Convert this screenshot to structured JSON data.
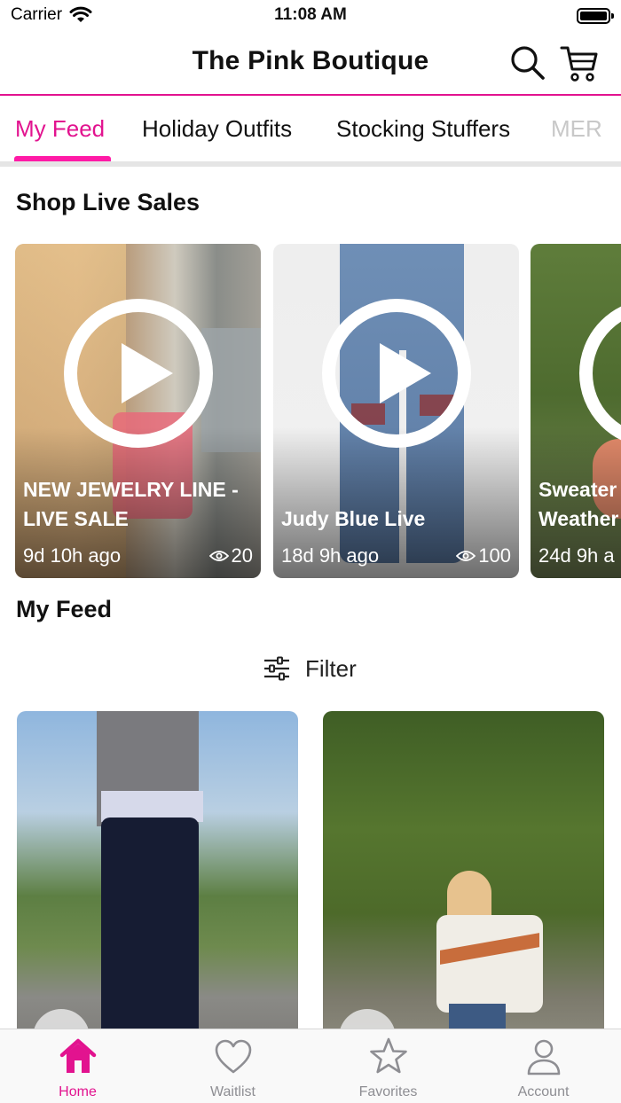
{
  "status_bar": {
    "carrier": "Carrier",
    "time": "11:08 AM"
  },
  "header": {
    "title": "The Pink Boutique",
    "search_icon": "search-icon",
    "cart_icon": "cart-icon"
  },
  "tabs": [
    {
      "label": "My Feed",
      "active": true
    },
    {
      "label": "Holiday Outfits"
    },
    {
      "label": "Stocking Stuffers"
    },
    {
      "label": "MER"
    }
  ],
  "live_section": {
    "title": "Shop Live Sales",
    "cards": [
      {
        "title": "NEW JEWELRY LINE -\nLIVE SALE",
        "ago": "9d 10h ago",
        "views": "20"
      },
      {
        "title": "Judy Blue Live",
        "ago": "18d 9h ago",
        "views": "100"
      },
      {
        "title": "Sweater\nWeather",
        "ago": "24d 9h a",
        "views": ""
      }
    ]
  },
  "feed_section": {
    "title": "My Feed",
    "filter_label": "Filter"
  },
  "bottom_nav": [
    {
      "label": "Home",
      "icon": "home-icon",
      "active": true
    },
    {
      "label": "Waitlist",
      "icon": "heart-icon"
    },
    {
      "label": "Favorites",
      "icon": "star-icon"
    },
    {
      "label": "Account",
      "icon": "person-icon"
    }
  ],
  "colors": {
    "accent": "#e2138f",
    "tab_underline": "#ff1aa6",
    "nav_inactive": "#8e8e93"
  }
}
